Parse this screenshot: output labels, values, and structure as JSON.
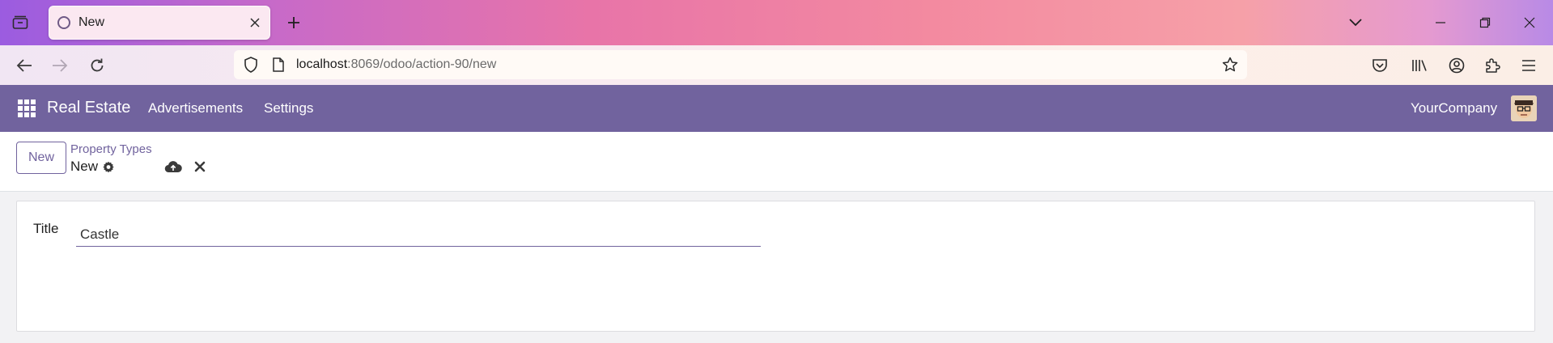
{
  "browser": {
    "tab": {
      "title": "New"
    },
    "url": {
      "host": "localhost",
      "rest": ":8069/odoo/action-90/new"
    }
  },
  "app": {
    "brand": "Real Estate",
    "menu": [
      {
        "label": "Advertisements"
      },
      {
        "label": "Settings"
      }
    ],
    "company": "YourCompany",
    "accent_color": "#71639e"
  },
  "control_panel": {
    "new_button": "New",
    "breadcrumb": "Property Types",
    "record_name": "New"
  },
  "form": {
    "title_label": "Title",
    "title_value": "Castle"
  }
}
